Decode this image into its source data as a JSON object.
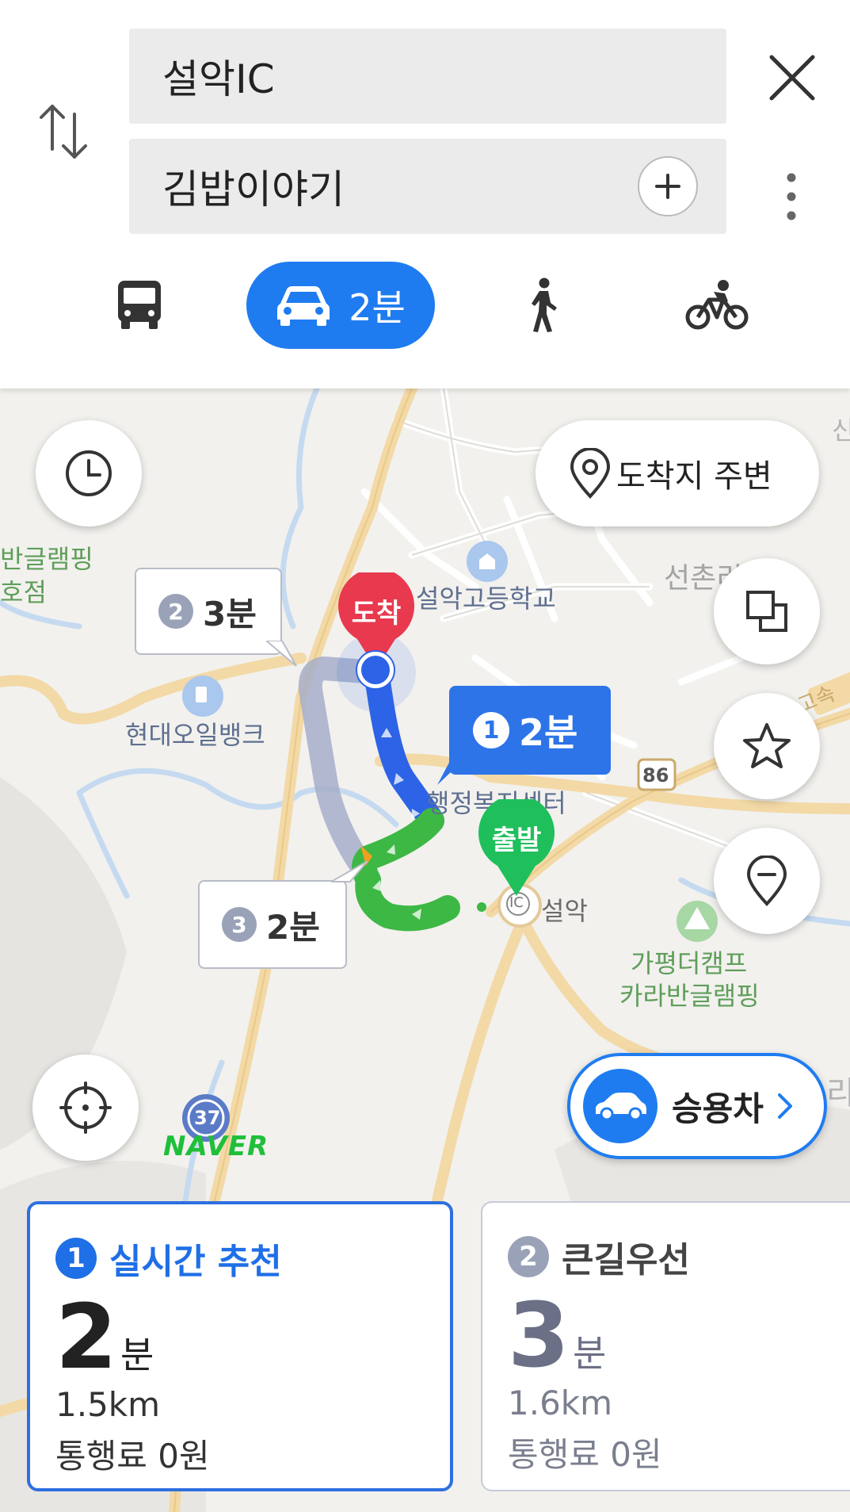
{
  "search": {
    "origin": "설악IC",
    "destination": "김밥이야기"
  },
  "modes": {
    "car_time": "2분"
  },
  "map": {
    "destination_around": "도착지 주변",
    "pin_arrive": "도착",
    "pin_depart": "출발",
    "routes": [
      {
        "num": "1",
        "time": "2분"
      },
      {
        "num": "2",
        "time": "3분"
      },
      {
        "num": "3",
        "time": "2분"
      }
    ],
    "labels": {
      "school": "설악고등학교",
      "gas": "현대오일뱅크",
      "admin": "행정복지센터",
      "ic": "설악",
      "ic_badge": "IC",
      "camp1": "가평더캠프",
      "camp2": "카라반글램핑",
      "seonchon": "선촌리",
      "left1": "반글램핑",
      "left2": "호점",
      "right_top": "신",
      "right_side": "고속",
      "right_mid": "리",
      "road86": "86",
      "road37": "37",
      "naver": "NAVER"
    },
    "vehicle_label": "승용차"
  },
  "cards": [
    {
      "num": "1",
      "title": "실시간 추천",
      "minutes": "2",
      "unit": "분",
      "distance": "1.5km",
      "toll": "통행료 0원"
    },
    {
      "num": "2",
      "title": "큰길우선",
      "minutes": "3",
      "unit": "분",
      "distance": "1.6km",
      "toll": "통행료 0원"
    }
  ],
  "colors": {
    "accent": "#1f7cf0",
    "route1": "#2d63e6",
    "route2": "#a6aec9",
    "route3": "#3db845",
    "arrive_pin": "#e8394f",
    "depart_pin": "#1fbf5c"
  }
}
